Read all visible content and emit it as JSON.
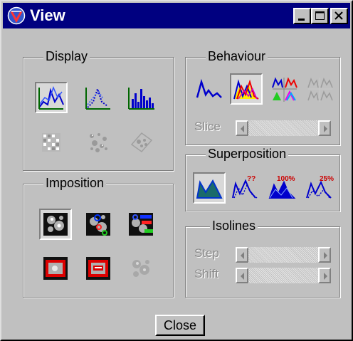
{
  "window": {
    "title": "View",
    "app_icon": "view-app-icon",
    "controls": [
      {
        "name": "minimize",
        "icon": "minimize-icon"
      },
      {
        "name": "maximize",
        "icon": "maximize-icon"
      },
      {
        "name": "close",
        "icon": "close-icon"
      }
    ]
  },
  "display": {
    "label": "Display",
    "buttons": [
      {
        "icon": "surface-plot-icon",
        "selected": true,
        "enabled": true
      },
      {
        "icon": "dotted-peak-icon",
        "selected": false,
        "enabled": true
      },
      {
        "icon": "bar-histogram-icon",
        "selected": false,
        "enabled": true
      },
      {
        "icon": "grid-matrix-icon",
        "selected": false,
        "enabled": false
      },
      {
        "icon": "scatter-map-icon",
        "selected": false,
        "enabled": false
      },
      {
        "icon": "rotated-map-icon",
        "selected": false,
        "enabled": false
      }
    ]
  },
  "behaviour": {
    "label": "Behaviour",
    "buttons": [
      {
        "icon": "single-spectrum-icon",
        "selected": false,
        "enabled": true
      },
      {
        "icon": "overlay-spectra-icon",
        "selected": true,
        "enabled": true
      },
      {
        "icon": "tiled-spectra-icon",
        "selected": false,
        "enabled": true
      },
      {
        "icon": "tiled-gray-spectra-icon",
        "selected": false,
        "enabled": false
      }
    ],
    "slice_label": "Slice"
  },
  "superposition": {
    "label": "Superposition",
    "buttons": [
      {
        "icon": "filled-area-icon",
        "selected": true,
        "enabled": true,
        "badge": ""
      },
      {
        "icon": "question-overlay-icon",
        "selected": false,
        "enabled": true,
        "badge": "??"
      },
      {
        "icon": "percent-100-icon",
        "selected": false,
        "enabled": true,
        "badge": "100%"
      },
      {
        "icon": "percent-25-icon",
        "selected": false,
        "enabled": true,
        "badge": "25%"
      }
    ]
  },
  "imposition": {
    "label": "Imposition",
    "buttons": [
      {
        "icon": "gray-map-icon",
        "selected": true,
        "enabled": true
      },
      {
        "icon": "map-circles-icon",
        "selected": false,
        "enabled": true
      },
      {
        "icon": "map-labels-icon",
        "selected": false,
        "enabled": true
      },
      {
        "icon": "red-frame-icon",
        "selected": false,
        "enabled": true
      },
      {
        "icon": "red-frame-label-icon",
        "selected": false,
        "enabled": true
      },
      {
        "icon": "gray-map-disabled-icon",
        "selected": false,
        "enabled": false
      }
    ]
  },
  "isolines": {
    "label": "Isolines",
    "step_label": "Step",
    "shift_label": "Shift"
  },
  "footer": {
    "close_label": "Close"
  },
  "colors": {
    "title_bar": "#000080",
    "face": "#c0c0c0",
    "icon_blue": "#0000cc",
    "icon_red": "#cc0000",
    "icon_green": "#008000",
    "disabled": "#8a8a8a"
  }
}
